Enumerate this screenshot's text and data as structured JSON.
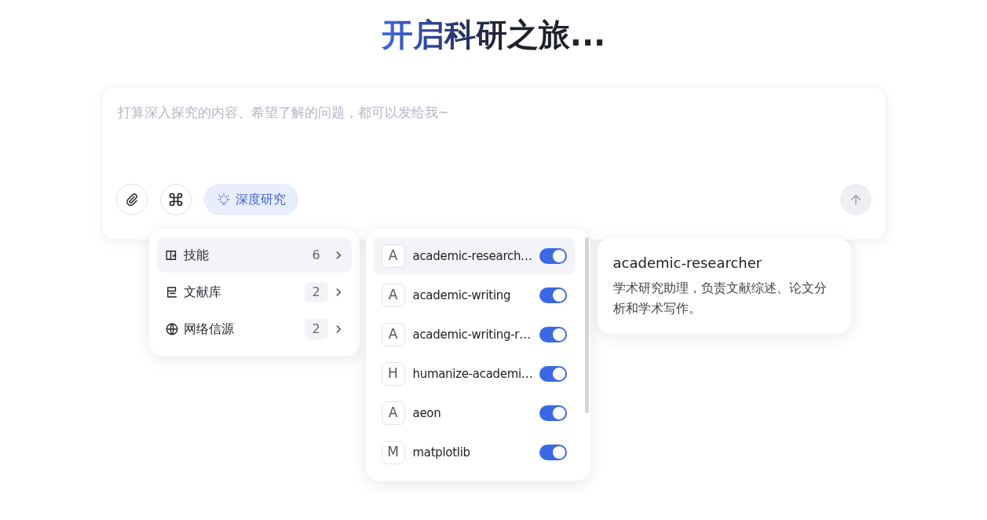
{
  "title": "开启科研之旅...",
  "composer": {
    "placeholder": "打算深入探究的内容、希望了解的问题，都可以发给我~",
    "mode_chip": {
      "label": "深度研究",
      "on": true
    }
  },
  "menu": [
    {
      "kind": "skills",
      "label": "技能",
      "count": "6",
      "selected": true
    },
    {
      "kind": "library",
      "label": "文献库",
      "count": "2",
      "selected": false
    },
    {
      "kind": "web",
      "label": "网络信源",
      "count": "2",
      "selected": false
    }
  ],
  "skills": [
    {
      "letter": "A",
      "name": "academic-research…",
      "on": true,
      "selected": true
    },
    {
      "letter": "A",
      "name": "academic-writing",
      "on": true,
      "selected": false
    },
    {
      "letter": "A",
      "name": "academic-writing-r…",
      "on": true,
      "selected": false
    },
    {
      "letter": "H",
      "name": "humanize-academi…",
      "on": true,
      "selected": false
    },
    {
      "letter": "A",
      "name": "aeon",
      "on": true,
      "selected": false
    },
    {
      "letter": "M",
      "name": "matplotlib",
      "on": true,
      "selected": false
    }
  ],
  "tooltip": {
    "title": "academic-researcher",
    "description": "学术研究助理，负责文献综述、论文分析和学术写作。"
  }
}
